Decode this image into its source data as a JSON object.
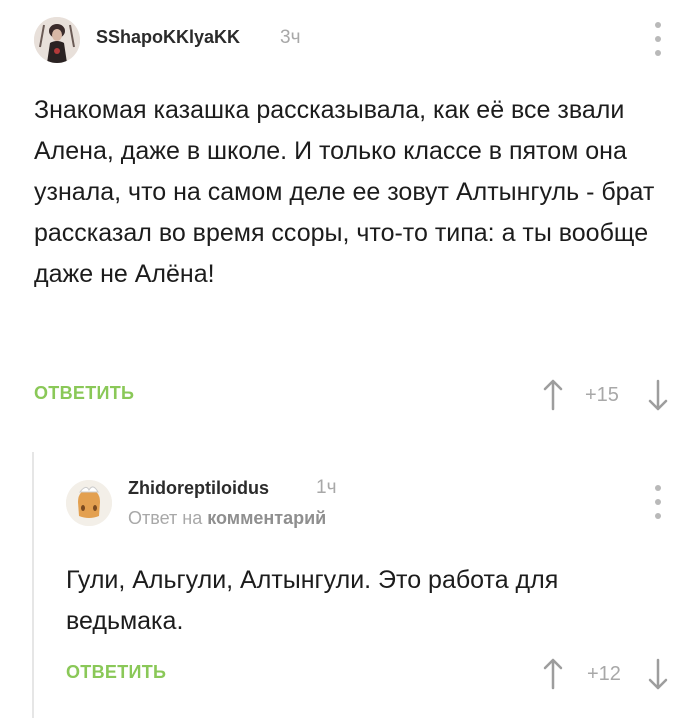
{
  "comment": {
    "username": "SShapoKKlyaKK",
    "time": "3ч",
    "text": "Знакомая казашка рассказывала, как её все звали Алена, даже в школе. И только классе в пятом она узнала, что на самом деле ее зовут Алтынгуль - брат рассказал во время ссоры, что-то типа: а ты вообще даже не Алёна!",
    "reply_label": "ОТВЕТИТЬ",
    "rating": "+15"
  },
  "reply": {
    "username": "Zhidoreptiloidus",
    "time": "1ч",
    "reply_prefix": "Ответ на",
    "reply_target": "комментарий",
    "text": "Гули, Альгули, Алтынгули. Это работа для ведьмака.",
    "reply_label": "ОТВЕТИТЬ",
    "rating": "+12"
  },
  "colors": {
    "accent_green": "#8ac858",
    "muted_gray": "#a8a8a8"
  },
  "icons": [
    "avatar",
    "more-vertical-icon",
    "arrow-up-icon",
    "arrow-down-icon"
  ]
}
